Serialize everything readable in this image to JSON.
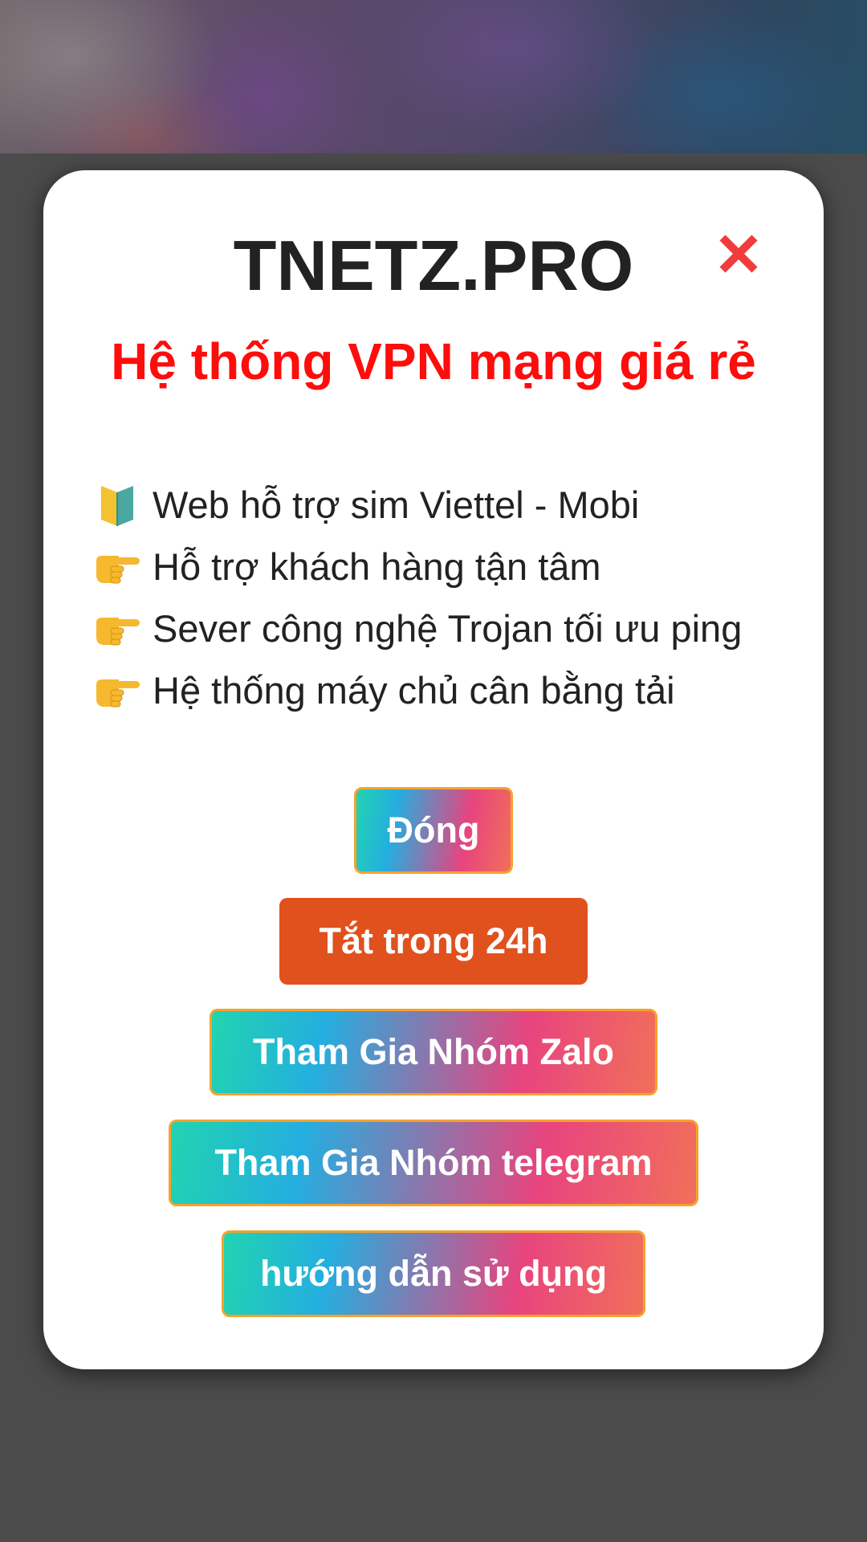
{
  "modal": {
    "title": "TNETZ.PRO",
    "subtitle": "Hệ thống VPN mạng giá rẻ",
    "close_icon": "close-icon",
    "features": [
      {
        "icon": "beginner-badge-icon",
        "text": "Web hỗ trợ sim Viettel - Mobi"
      },
      {
        "icon": "pointing-hand-icon",
        "text": "Hỗ trợ khách hàng tận tâm"
      },
      {
        "icon": "pointing-hand-icon",
        "text": "Sever công nghệ Trojan tối ưu ping"
      },
      {
        "icon": "pointing-hand-icon",
        "text": "Hệ thống máy chủ cân bằng tải"
      }
    ],
    "buttons": {
      "close": "Đóng",
      "disable_24h": "Tắt trong 24h",
      "zalo": "Tham Gia Nhóm Zalo",
      "telegram": "Tham Gia Nhóm telegram",
      "guide": "hướng dẫn sử dụng"
    }
  },
  "colors": {
    "title": "#222222",
    "subtitle": "#ff0c0c",
    "close_icon": "#f03c3c",
    "button_orange": "#e0511d",
    "button_border": "#f6a22e",
    "gradient_start": "#21d4b0",
    "gradient_mid": "#24aee0",
    "gradient_pink": "#e8447e",
    "gradient_end": "#f16f5a",
    "overlay": "#4b4b4b"
  }
}
